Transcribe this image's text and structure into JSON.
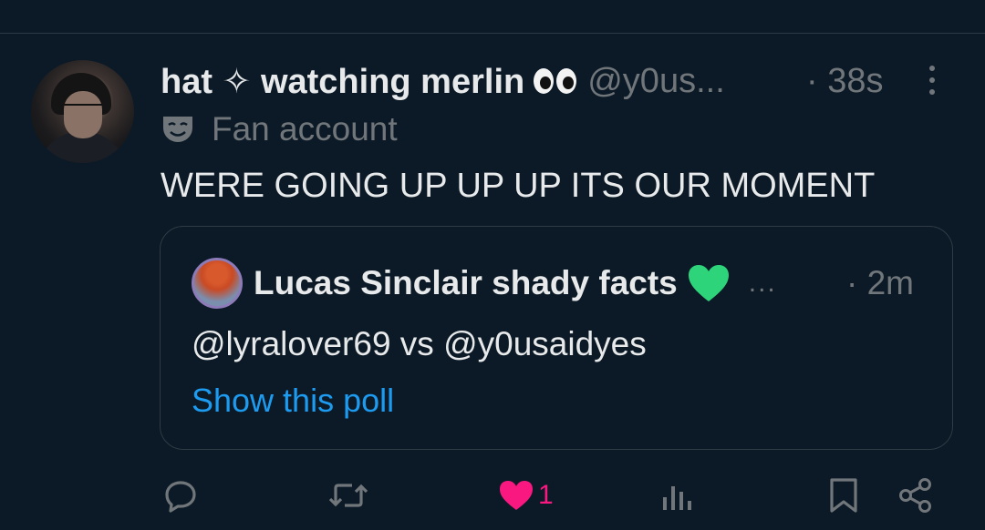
{
  "tweet": {
    "display_name": "hat ✧ watching merlin",
    "handle": "@y0us...",
    "time": "· 38s",
    "badge_label": "Fan account",
    "text": "WERE GOING UP UP UP ITS OUR MOMENT"
  },
  "quote": {
    "display_name": "Lucas Sinclair shady facts",
    "ellipsis": "...",
    "time": "· 2m",
    "text": "@lyralover69 vs @y0usaidyes",
    "poll_link": "Show this poll"
  },
  "actions": {
    "like_count": "1"
  },
  "icons": {
    "reply": "reply-icon",
    "retweet": "retweet-icon",
    "like": "heart-icon",
    "views": "views-icon",
    "bookmark": "bookmark-icon",
    "share": "share-icon",
    "more": "more-icon",
    "badge": "mask-icon"
  },
  "colors": {
    "background": "#0b1a26",
    "text": "#e7e9ea",
    "muted": "#71767b",
    "link": "#1d9bf0",
    "like": "#f91880",
    "green_heart": "#2ed47a"
  }
}
